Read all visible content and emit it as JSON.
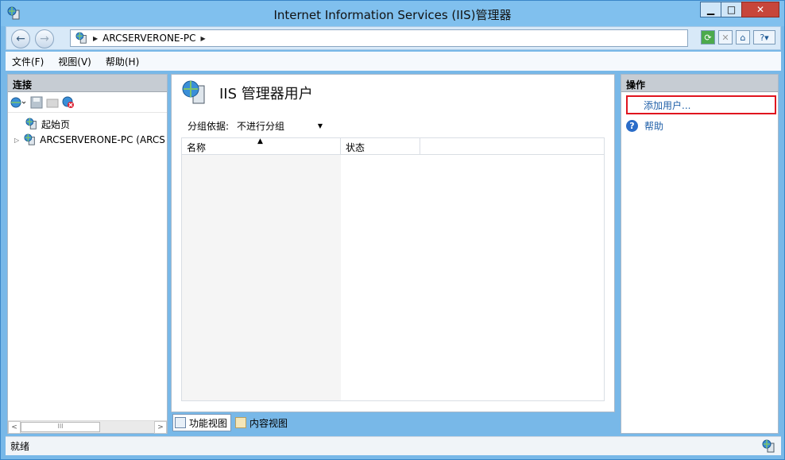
{
  "window": {
    "title": "Internet Information Services (IIS)管理器",
    "minimize": "▁",
    "maximize": "□",
    "close": "✕"
  },
  "address": {
    "back_icon": "back-arrow-icon",
    "forward_icon": "forward-arrow-icon",
    "segments": [
      "ARCSERVERONE-PC"
    ]
  },
  "menu": {
    "items": [
      "文件(F)",
      "视图(V)",
      "帮助(H)"
    ]
  },
  "connections": {
    "header": "连接",
    "tree": [
      {
        "label": "起始页"
      },
      {
        "label": "ARCSERVERONE-PC (ARCS"
      }
    ]
  },
  "center": {
    "title": "IIS 管理器用户",
    "groupby_label": "分组依据:",
    "groupby_value": "不进行分组",
    "columns": [
      "名称",
      "状态"
    ]
  },
  "bottom_tabs": {
    "features_view": "功能视图",
    "content_view": "内容视图"
  },
  "actions": {
    "header": "操作",
    "add_user": "添加用户...",
    "help": "帮助"
  },
  "status": {
    "text": "就绪"
  },
  "colors": {
    "title_bar": "#80c0ee",
    "close_button": "#c7463b",
    "link": "#1f5fa8",
    "highlight_border": "#e0141e"
  }
}
